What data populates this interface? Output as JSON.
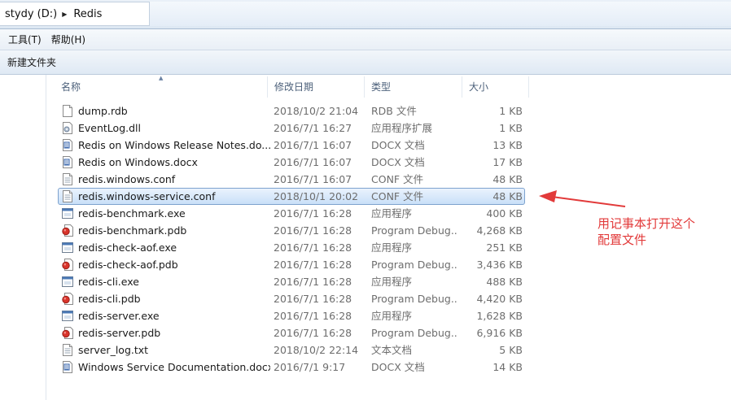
{
  "address": {
    "drive_label": "stydy (D:)",
    "folder_label": "Redis"
  },
  "menu": {
    "items": [
      {
        "label": "工具(T)"
      },
      {
        "label": "帮助(H)"
      }
    ]
  },
  "toolbar": {
    "new_folder_label": "新建文件夹"
  },
  "columns": {
    "name": "名称",
    "date": "修改日期",
    "type": "类型",
    "size": "大小"
  },
  "files": [
    {
      "name": "dump.rdb",
      "date": "2018/10/2 21:04",
      "type": "RDB 文件",
      "size": "1 KB",
      "icon": "generic-file-icon"
    },
    {
      "name": "EventLog.dll",
      "date": "2016/7/1 16:27",
      "type": "应用程序扩展",
      "size": "1 KB",
      "icon": "dll-file-icon"
    },
    {
      "name": "Redis on Windows Release Notes.do...",
      "date": "2016/7/1 16:07",
      "type": "DOCX 文档",
      "size": "13 KB",
      "icon": "docx-file-icon"
    },
    {
      "name": "Redis on Windows.docx",
      "date": "2016/7/1 16:07",
      "type": "DOCX 文档",
      "size": "17 KB",
      "icon": "docx-file-icon"
    },
    {
      "name": "redis.windows.conf",
      "date": "2016/7/1 16:07",
      "type": "CONF 文件",
      "size": "48 KB",
      "icon": "text-file-icon"
    },
    {
      "name": "redis.windows-service.conf",
      "date": "2018/10/1 20:02",
      "type": "CONF 文件",
      "size": "48 KB",
      "icon": "text-file-icon",
      "selected": true
    },
    {
      "name": "redis-benchmark.exe",
      "date": "2016/7/1 16:28",
      "type": "应用程序",
      "size": "400 KB",
      "icon": "exe-file-icon"
    },
    {
      "name": "redis-benchmark.pdb",
      "date": "2016/7/1 16:28",
      "type": "Program Debug...",
      "size": "4,268 KB",
      "icon": "pdb-file-icon"
    },
    {
      "name": "redis-check-aof.exe",
      "date": "2016/7/1 16:28",
      "type": "应用程序",
      "size": "251 KB",
      "icon": "exe-file-icon"
    },
    {
      "name": "redis-check-aof.pdb",
      "date": "2016/7/1 16:28",
      "type": "Program Debug...",
      "size": "3,436 KB",
      "icon": "pdb-file-icon"
    },
    {
      "name": "redis-cli.exe",
      "date": "2016/7/1 16:28",
      "type": "应用程序",
      "size": "488 KB",
      "icon": "exe-file-icon"
    },
    {
      "name": "redis-cli.pdb",
      "date": "2016/7/1 16:28",
      "type": "Program Debug...",
      "size": "4,420 KB",
      "icon": "pdb-file-icon"
    },
    {
      "name": "redis-server.exe",
      "date": "2016/7/1 16:28",
      "type": "应用程序",
      "size": "1,628 KB",
      "icon": "exe-file-icon"
    },
    {
      "name": "redis-server.pdb",
      "date": "2016/7/1 16:28",
      "type": "Program Debug...",
      "size": "6,916 KB",
      "icon": "pdb-file-icon"
    },
    {
      "name": "server_log.txt",
      "date": "2018/10/2 22:14",
      "type": "文本文档",
      "size": "5 KB",
      "icon": "text-file-icon"
    },
    {
      "name": "Windows Service Documentation.docx",
      "date": "2016/7/1 9:17",
      "type": "DOCX 文档",
      "size": "14 KB",
      "icon": "docx-file-icon"
    }
  ],
  "annotation": {
    "line1": "用记事本打开这个",
    "line2": "配置文件",
    "color": "#e23a3a"
  },
  "colors": {
    "selection": "#cce4f7",
    "selection_border": "#7da2ce",
    "annotation": "#e23a3a"
  }
}
